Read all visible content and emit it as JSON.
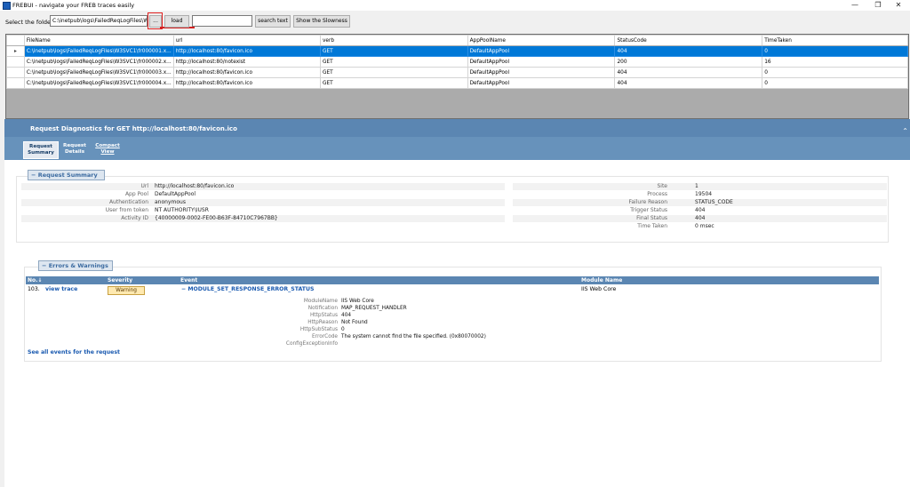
{
  "window": {
    "title": "FREBUI - navigate your FREB traces easily",
    "minimize": "—",
    "maximize": "❐",
    "close": "✕"
  },
  "toolbar": {
    "folder_label": "Select the folder",
    "folder_value": "C:\\inetpub\\logs\\FailedReqLogFiles\\W",
    "browse_label": "...",
    "load_label": "load",
    "search_value": "",
    "search_label": "search text",
    "slowness_label": "Show the Slowness"
  },
  "grid": {
    "columns": [
      "FileName",
      "url",
      "verb",
      "AppPoolName",
      "StatusCode",
      "TimeTaken"
    ],
    "selected_marker": "▸",
    "rows": [
      [
        "C:\\inetpub\\logs\\FailedReqLogFiles\\W3SVC1\\fr000001.x...",
        "http://localhost:80/favicon.ico",
        "GET",
        "DefaultAppPool",
        "404",
        "0"
      ],
      [
        "C:\\inetpub\\logs\\FailedReqLogFiles\\W3SVC1\\fr000002.x...",
        "http://localhost:80/notexist",
        "GET",
        "DefaultAppPool",
        "200",
        "16"
      ],
      [
        "C:\\inetpub\\logs\\FailedReqLogFiles\\W3SVC1\\fr000003.x...",
        "http://localhost:80/favicon.ico",
        "GET",
        "DefaultAppPool",
        "404",
        "0"
      ],
      [
        "C:\\inetpub\\logs\\FailedReqLogFiles\\W3SVC1\\fr000004.x...",
        "http://localhost:80/favicon.ico",
        "GET",
        "DefaultAppPool",
        "404",
        "0"
      ]
    ]
  },
  "diagnostics": {
    "title": "Request Diagnostics for GET http://localhost:80/favicon.ico",
    "tabs": {
      "summary_1": "Request",
      "summary_2": "Summary",
      "details_1": "Request",
      "details_2": "Details",
      "compact_1": "Compact",
      "compact_2": "View"
    },
    "summary_legend": "− Request Summary",
    "summary_left": [
      {
        "k": "Url",
        "v": "http://localhost:80/favicon.ico"
      },
      {
        "k": "App Pool",
        "v": "DefaultAppPool"
      },
      {
        "k": "Authentication",
        "v": "anonymous"
      },
      {
        "k": "User from token",
        "v": "NT AUTHORITY\\IUSR"
      },
      {
        "k": "Activity ID",
        "v": "{40000009-0002-FE00-B63F-84710C7967BB}"
      }
    ],
    "summary_right": [
      {
        "k": "Site",
        "v": "1"
      },
      {
        "k": "Process",
        "v": "19504"
      },
      {
        "k": "Failure Reason",
        "v": "STATUS_CODE"
      },
      {
        "k": "Trigger Status",
        "v": "404"
      },
      {
        "k": "Final Status",
        "v": "404"
      },
      {
        "k": "Time Taken",
        "v": "0 msec"
      }
    ],
    "errors_legend": "− Errors & Warnings",
    "errors_columns": {
      "no": "No.↓",
      "severity": "Severity",
      "event": "Event",
      "module": "Module Name"
    },
    "error_row": {
      "no": "103.",
      "trace_link": "view trace",
      "severity": "Warning",
      "event": "− MODULE_SET_RESPONSE_ERROR_STATUS",
      "module": "IIS Web Core"
    },
    "error_details": [
      {
        "k": "ModuleName",
        "v": "IIS Web Core"
      },
      {
        "k": "Notification",
        "v": "MAP_REQUEST_HANDLER"
      },
      {
        "k": "HttpStatus",
        "v": "404"
      },
      {
        "k": "HttpReason",
        "v": "Not Found"
      },
      {
        "k": "HttpSubStatus",
        "v": "0"
      },
      {
        "k": "ErrorCode",
        "v": "The system cannot find the file specified. (0x80070002)"
      },
      {
        "k": "ConfigExceptionInfo",
        "v": ""
      }
    ],
    "see_all": "See all events for the request"
  },
  "colors": {
    "selection": "#0078d7",
    "header_band": "#5b86b2",
    "highlight": "#e02020"
  }
}
